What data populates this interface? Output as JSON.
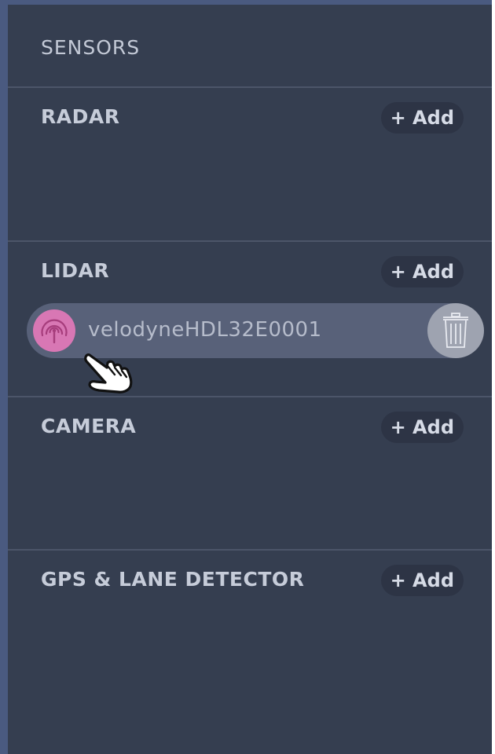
{
  "panel": {
    "title": "SENSORS"
  },
  "sections": [
    {
      "title": "RADAR",
      "add_label": "+ Add",
      "items": []
    },
    {
      "title": "LIDAR",
      "add_label": "+ Add",
      "items": [
        {
          "label": "velodyneHDL32E0001",
          "icon": "signal-tower-icon",
          "icon_color": "#d877b4"
        }
      ]
    },
    {
      "title": "CAMERA",
      "add_label": "+ Add",
      "items": []
    },
    {
      "title": "GPS & LANE DETECTOR",
      "add_label": "+ Add",
      "items": []
    }
  ],
  "colors": {
    "panel_background": "#353e50",
    "item_background": "#586179",
    "accent": "#d877b4"
  }
}
